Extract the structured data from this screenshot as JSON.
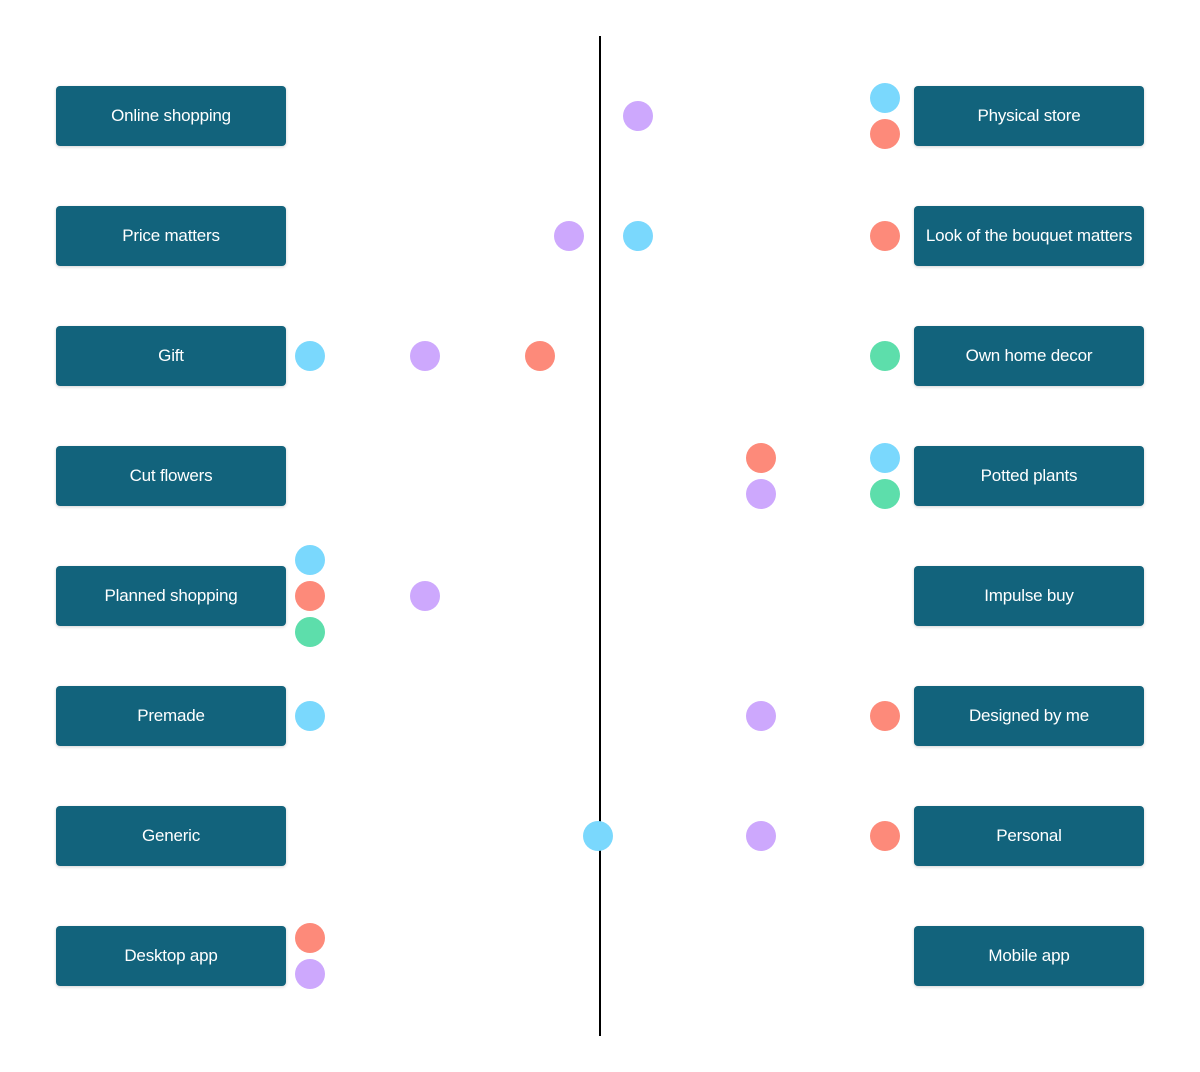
{
  "colors": {
    "label_bg": "#12637c",
    "axis": "#000000",
    "blue": "#7ad8fd",
    "red": "#fd8a7a",
    "purple": "#cda8fd",
    "green": "#5ddeab"
  },
  "chart_data": {
    "type": "scatter",
    "description": "Semantic differential: each row is a dimension between two poles; dots are participant placements on a scale from 0 (left pole) to 1 (right pole), 0.5 = center axis",
    "rows": [
      {
        "left": "Online shopping",
        "right": "Physical store",
        "points": [
          {
            "color": "purple",
            "pos": 0.57
          },
          {
            "color": "blue",
            "pos": 1.0,
            "stack": -1
          },
          {
            "color": "red",
            "pos": 1.0,
            "stack": 1
          }
        ]
      },
      {
        "left": "Price matters",
        "right": "Look of the bouquet matters",
        "points": [
          {
            "color": "purple",
            "pos": 0.45
          },
          {
            "color": "blue",
            "pos": 0.57
          },
          {
            "color": "red",
            "pos": 1.0
          }
        ]
      },
      {
        "left": "Gift",
        "right": "Own home decor",
        "points": [
          {
            "color": "blue",
            "pos": 0.0
          },
          {
            "color": "purple",
            "pos": 0.2
          },
          {
            "color": "red",
            "pos": 0.4
          },
          {
            "color": "green",
            "pos": 1.0
          }
        ]
      },
      {
        "left": "Cut flowers",
        "right": "Potted plants",
        "points": [
          {
            "color": "red",
            "pos": 0.785,
            "stack": -1
          },
          {
            "color": "purple",
            "pos": 0.785,
            "stack": 1
          },
          {
            "color": "blue",
            "pos": 1.0,
            "stack": -1
          },
          {
            "color": "green",
            "pos": 1.0,
            "stack": 1
          }
        ]
      },
      {
        "left": "Planned shopping",
        "right": "Impulse buy",
        "points": [
          {
            "color": "blue",
            "pos": 0.0,
            "stack": -2
          },
          {
            "color": "red",
            "pos": 0.0,
            "stack": 0
          },
          {
            "color": "green",
            "pos": 0.0,
            "stack": 2
          },
          {
            "color": "purple",
            "pos": 0.2
          }
        ]
      },
      {
        "left": "Premade",
        "right": "Designed by me",
        "points": [
          {
            "color": "blue",
            "pos": 0.0
          },
          {
            "color": "purple",
            "pos": 0.785
          },
          {
            "color": "red",
            "pos": 1.0
          }
        ]
      },
      {
        "left": "Generic",
        "right": "Personal",
        "points": [
          {
            "color": "blue",
            "pos": 0.5
          },
          {
            "color": "purple",
            "pos": 0.785
          },
          {
            "color": "red",
            "pos": 1.0
          }
        ]
      },
      {
        "left": "Desktop app",
        "right": "Mobile app",
        "points": [
          {
            "color": "red",
            "pos": 0.0,
            "stack": -1
          },
          {
            "color": "purple",
            "pos": 0.0,
            "stack": 1
          }
        ]
      }
    ]
  }
}
